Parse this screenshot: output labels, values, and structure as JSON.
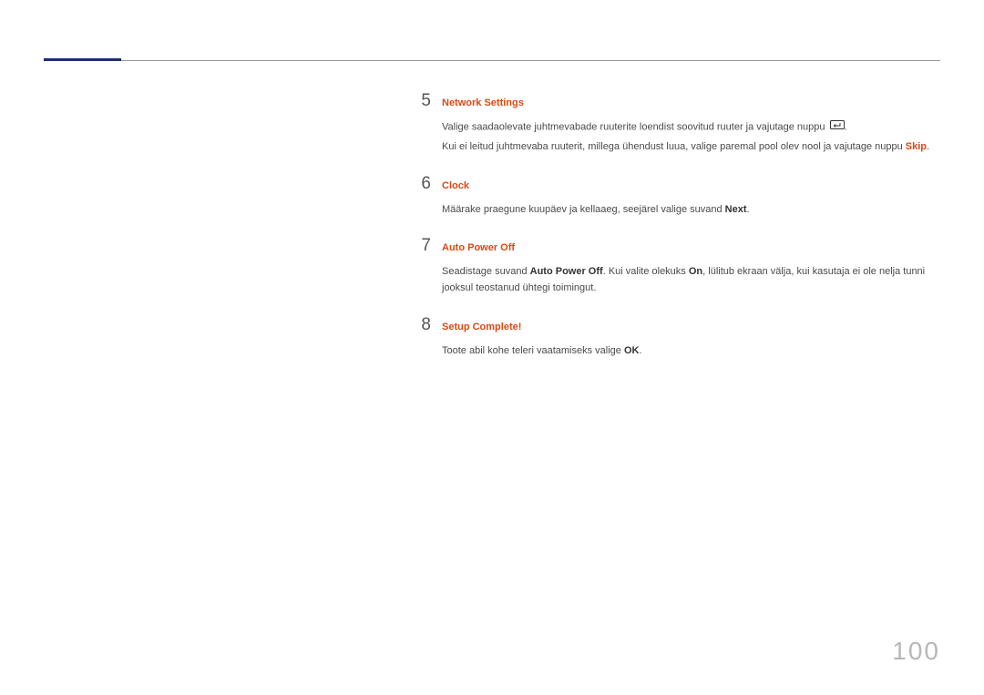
{
  "steps": [
    {
      "num": "5",
      "title": "Network Settings",
      "lines": [
        {
          "pre": "Valige saadaolevate juhtmevabade ruuterite loendist soovitud ruuter ja vajutage nuppu ",
          "icon": true,
          "post": "."
        },
        {
          "pre": "Kui ei leitud juhtmevaba ruuterit, millega ühendust luua, valige paremal pool olev nool ja vajutage nuppu ",
          "skip": "Skip",
          "post": "."
        }
      ]
    },
    {
      "num": "6",
      "title": "Clock",
      "lines": [
        {
          "pre": "Määrake praegune kuupäev ja kellaaeg, seejärel valige suvand ",
          "bold": "Next",
          "post": "."
        }
      ]
    },
    {
      "num": "7",
      "title": "Auto Power Off",
      "lines": [
        {
          "pre": "Seadistage suvand ",
          "bold": "Auto Power Off",
          "post": ". Kui valite olekuks ",
          "bold2": "On",
          "post2": ", lülitub ekraan välja, kui kasutaja ei ole nelja tunni jooksul teostanud ühtegi toimingut."
        }
      ]
    },
    {
      "num": "8",
      "title": "Setup Complete!",
      "lines": [
        {
          "pre": "Toote abil kohe teleri vaatamiseks valige ",
          "bold": "OK",
          "post": "."
        }
      ]
    }
  ],
  "pageNumber": "100"
}
